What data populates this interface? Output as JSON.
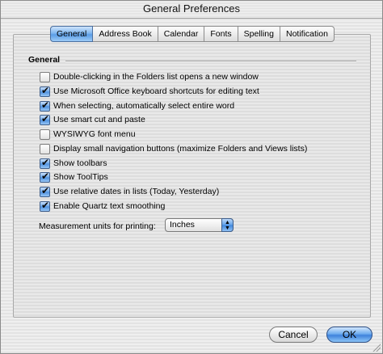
{
  "window": {
    "title": "General Preferences"
  },
  "tabs": [
    {
      "label": "General",
      "active": true
    },
    {
      "label": "Address Book",
      "active": false
    },
    {
      "label": "Calendar",
      "active": false
    },
    {
      "label": "Fonts",
      "active": false
    },
    {
      "label": "Spelling",
      "active": false
    },
    {
      "label": "Notification",
      "active": false
    }
  ],
  "group": {
    "label": "General"
  },
  "options": [
    {
      "label": "Double-clicking in the Folders list opens a new window",
      "checked": false
    },
    {
      "label": "Use Microsoft Office keyboard shortcuts for editing text",
      "checked": true
    },
    {
      "label": "When selecting, automatically select entire word",
      "checked": true
    },
    {
      "label": "Use smart cut and paste",
      "checked": true
    },
    {
      "label": "WYSIWYG font menu",
      "checked": false
    },
    {
      "label": "Display small navigation buttons (maximize Folders and Views lists)",
      "checked": false
    },
    {
      "label": "Show toolbars",
      "checked": true
    },
    {
      "label": "Show ToolTips",
      "checked": true
    },
    {
      "label": "Use relative dates in lists (Today, Yesterday)",
      "checked": true
    },
    {
      "label": "Enable Quartz text smoothing",
      "checked": true
    }
  ],
  "measurement": {
    "label": "Measurement units for printing:",
    "value": "Inches"
  },
  "buttons": {
    "cancel": "Cancel",
    "ok": "OK"
  },
  "colors": {
    "accent": "#5a9ce6",
    "panel_stripe": "#e3e3e3"
  }
}
